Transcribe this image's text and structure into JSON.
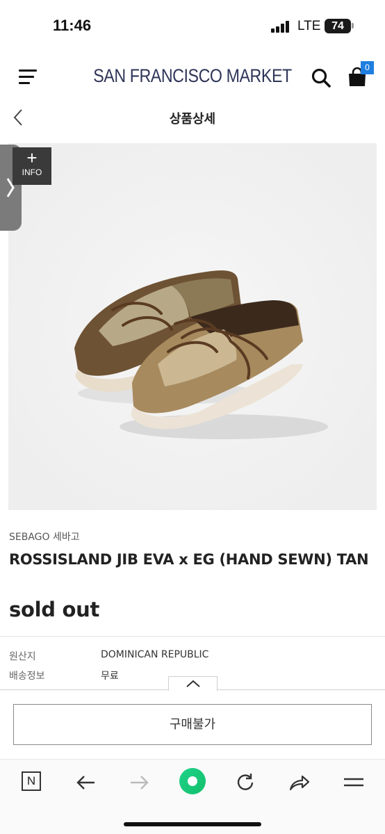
{
  "status_bar": {
    "time": "11:46",
    "network": "LTE",
    "battery": "74"
  },
  "header": {
    "brand": "SAN FRANCISCO MARKET",
    "cart_count": "0",
    "accent_color": "#1f7fe0"
  },
  "subheader": {
    "title": "상품상세"
  },
  "gallery": {
    "info_plus": "+",
    "info_label": "INFO"
  },
  "product": {
    "brand": "SEBAGO 세바고",
    "name": "ROSSISLAND JIB EVA x EG (HAND SEWN) TAN",
    "status": "sold out"
  },
  "details": [
    {
      "key": "원산지",
      "value": "DOMINICAN REPUBLIC"
    },
    {
      "key": "배송정보",
      "value": "무료"
    }
  ],
  "actions": {
    "buy_label": "구매불가"
  },
  "toolbar": {
    "n_label": "N"
  }
}
